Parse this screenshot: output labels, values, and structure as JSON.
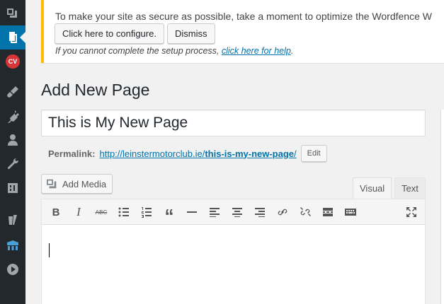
{
  "sidebar": {
    "items": [
      {
        "icon": "media-icon"
      },
      {
        "icon": "pages-icon",
        "active": true
      },
      {
        "icon": "cv-badge-icon",
        "badge": "CV"
      },
      {
        "icon": "appearance-icon"
      },
      {
        "icon": "plugins-icon"
      },
      {
        "icon": "users-icon"
      },
      {
        "icon": "tools-icon"
      },
      {
        "icon": "settings-icon"
      },
      {
        "icon": "yoast-icon"
      },
      {
        "icon": "wordfence-icon"
      },
      {
        "icon": "play-icon"
      }
    ]
  },
  "notice": {
    "message": "To make your site as secure as possible, take a moment to optimize the Wordfence W",
    "configure_label": "Click here to configure.",
    "dismiss_label": "Dismiss",
    "help_prefix": "If you cannot complete the setup process, ",
    "help_link": "click here for help",
    "help_suffix": ".",
    "accent": "#ffb900"
  },
  "page": {
    "title": "Add New Page",
    "post_title_value": "This is My New Page"
  },
  "permalink": {
    "label": "Permalink:",
    "base_url": "http://leinstermotorclub.ie/",
    "slug": "this-is-my-new-page",
    "trailing": "/",
    "edit_label": "Edit"
  },
  "editor": {
    "add_media_label": "Add Media",
    "tab_visual": "Visual",
    "tab_text": "Text",
    "toolbar": [
      "bold-icon",
      "italic-icon",
      "strikethrough-icon",
      "bullet-list-icon",
      "numbered-list-icon",
      "blockquote-icon",
      "horizontal-rule-icon",
      "align-left-icon",
      "align-center-icon",
      "align-right-icon",
      "insert-link-icon",
      "remove-link-icon",
      "read-more-icon",
      "toolbar-toggle-icon",
      "fullscreen-icon"
    ],
    "toolbar_text": {
      "bold": "B",
      "italic": "I",
      "strikethrough": "ABC",
      "blockquote": "“"
    }
  },
  "colors": {
    "sidebar_bg": "#23282d",
    "active": "#0073aa",
    "link": "#0073aa"
  }
}
